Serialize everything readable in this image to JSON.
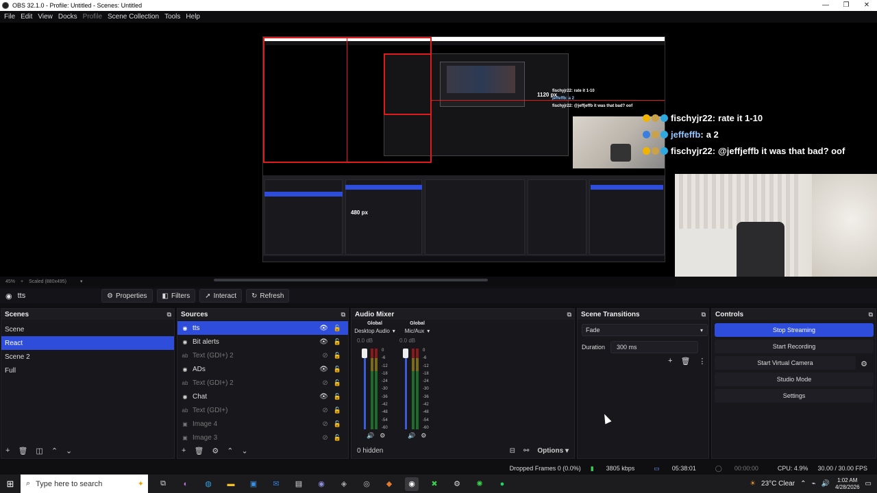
{
  "window": {
    "title": "OBS 32.1.0 - Profile: Untitled - Scenes: Untitled",
    "minimize": "—",
    "maximize": "❐",
    "close": "✕"
  },
  "menu": [
    "File",
    "Edit",
    "View",
    "Docks",
    "Profile",
    "Scene Collection",
    "Tools",
    "Help"
  ],
  "preview": {
    "chat": [
      {
        "name": "fischyjr22",
        "msg": "rate it 1-10",
        "name_color": "#ffffff"
      },
      {
        "name": "jeffeffb",
        "msg": "a 2",
        "name_color": "#8fc6ff"
      },
      {
        "name": "fischyjr22",
        "msg": "@jeffjeffb it was that bad? oof",
        "name_color": "#ffffff"
      }
    ],
    "nested_px_h": "480 px",
    "nested_px_w": "1120 px",
    "zoom": "45%",
    "scaled": "Scaled (880x495)"
  },
  "toolbar": {
    "source": "tts",
    "properties": "Properties",
    "filters": "Filters",
    "interact": "Interact",
    "refresh": "Refresh"
  },
  "scenes": {
    "title": "Scenes",
    "items": [
      "Scene",
      "React",
      "Scene 2",
      "Full"
    ],
    "selected": "React"
  },
  "sources": {
    "title": "Sources",
    "items": [
      {
        "name": "tts",
        "icon": "globe-icon",
        "visible": true,
        "selected": true
      },
      {
        "name": "Bit alerts",
        "icon": "globe-icon",
        "visible": true
      },
      {
        "name": "Text (GDI+) 2",
        "icon": "text-icon",
        "visible": false
      },
      {
        "name": "ADs",
        "icon": "globe-icon",
        "visible": true
      },
      {
        "name": "Text (GDI+) 2",
        "icon": "text-icon",
        "visible": false
      },
      {
        "name": "Chat",
        "icon": "globe-icon",
        "visible": true
      },
      {
        "name": "Text (GDI+)",
        "icon": "text-icon",
        "visible": false
      },
      {
        "name": "Image 4",
        "icon": "image-icon",
        "visible": false
      },
      {
        "name": "Image 3",
        "icon": "image-icon",
        "visible": false
      }
    ]
  },
  "mixer": {
    "title": "Audio Mixer",
    "channels": [
      {
        "global": "Global",
        "name": "Desktop Audio",
        "db": "0.0 dB"
      },
      {
        "global": "Global",
        "name": "Mic/Aux",
        "db": "0.0 dB"
      }
    ],
    "scale": [
      "0",
      "-6",
      "-12",
      "-18",
      "-24",
      "-30",
      "-36",
      "-42",
      "-48",
      "-54",
      "-60"
    ],
    "hidden": "0 hidden",
    "options": "Options"
  },
  "transitions": {
    "title": "Scene Transitions",
    "type": "Fade",
    "duration_label": "Duration",
    "duration": "300 ms"
  },
  "controls": {
    "title": "Controls",
    "stop_streaming": "Stop Streaming",
    "start_recording": "Start Recording",
    "start_virtual_camera": "Start Virtual Camera",
    "studio_mode": "Studio Mode",
    "settings": "Settings"
  },
  "status": {
    "dropped_frames": "Dropped Frames 0 (0.0%)",
    "bitrate": "3805 kbps",
    "stream_time": "05:38:01",
    "rec_time": "00:00:00",
    "cpu": "CPU: 4.9%",
    "fps": "30.00 / 30.00 FPS"
  },
  "taskbar": {
    "search_placeholder": "Type here to search",
    "weather": "23°C  Clear",
    "time": "1:02 AM",
    "date": "4/28/2026"
  },
  "colors": {
    "accent": "#2f4ddb",
    "recording_red": "#e01b1b"
  }
}
